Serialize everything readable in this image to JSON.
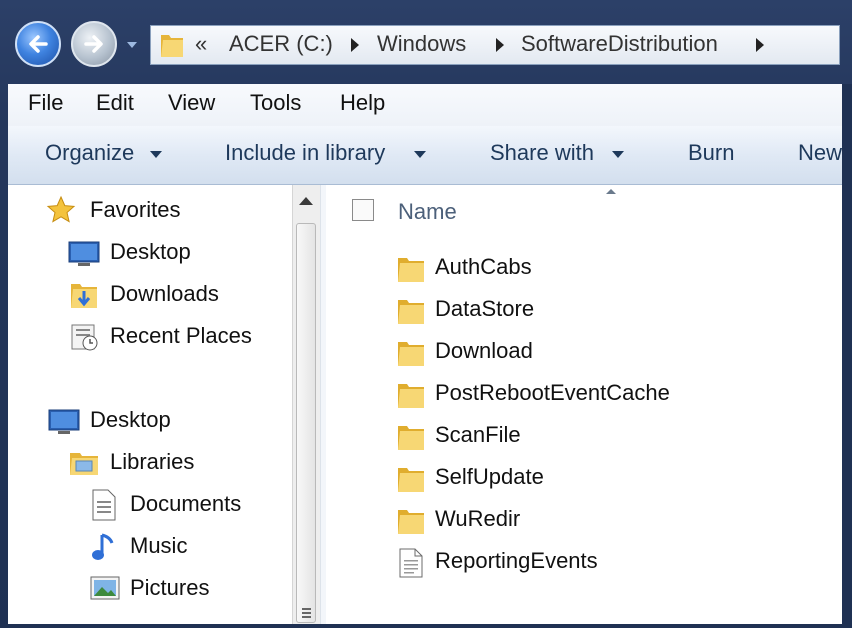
{
  "address_bar": {
    "overflow_chevron": "«",
    "crumbs": [
      "ACER (C:)",
      "Windows",
      "SoftwareDistribution"
    ]
  },
  "menu": [
    "File",
    "Edit",
    "View",
    "Tools",
    "Help"
  ],
  "toolbar": {
    "organize": "Organize",
    "include_in_library": "Include in library",
    "share_with": "Share with",
    "burn": "Burn",
    "new_folder": "New"
  },
  "nav_pane": {
    "favorites": "Favorites",
    "favorites_items": [
      "Desktop",
      "Downloads",
      "Recent Places"
    ],
    "desktop": "Desktop",
    "libraries": "Libraries",
    "library_items": [
      "Documents",
      "Music",
      "Pictures"
    ]
  },
  "content": {
    "column_name": "Name",
    "items": [
      {
        "name": "AuthCabs",
        "type": "folder"
      },
      {
        "name": "DataStore",
        "type": "folder"
      },
      {
        "name": "Download",
        "type": "folder"
      },
      {
        "name": "PostRebootEventCache",
        "type": "folder"
      },
      {
        "name": "ScanFile",
        "type": "folder"
      },
      {
        "name": "SelfUpdate",
        "type": "folder"
      },
      {
        "name": "WuRedir",
        "type": "folder"
      },
      {
        "name": "ReportingEvents",
        "type": "file"
      }
    ]
  },
  "icons": {
    "back": "back-arrow-icon",
    "forward": "forward-arrow-icon",
    "folder": "folder-icon",
    "file": "text-document-icon",
    "favorites": "star-icon",
    "desktop": "desktop-icon",
    "downloads": "downloads-icon",
    "recent": "recent-places-icon",
    "libraries": "libraries-icon",
    "documents": "documents-icon",
    "music": "music-note-icon",
    "pictures": "pictures-icon"
  },
  "colors": {
    "frame": "#24375c",
    "toolbar_text": "#1e395b",
    "folder_yellow": "#f2c94c"
  }
}
